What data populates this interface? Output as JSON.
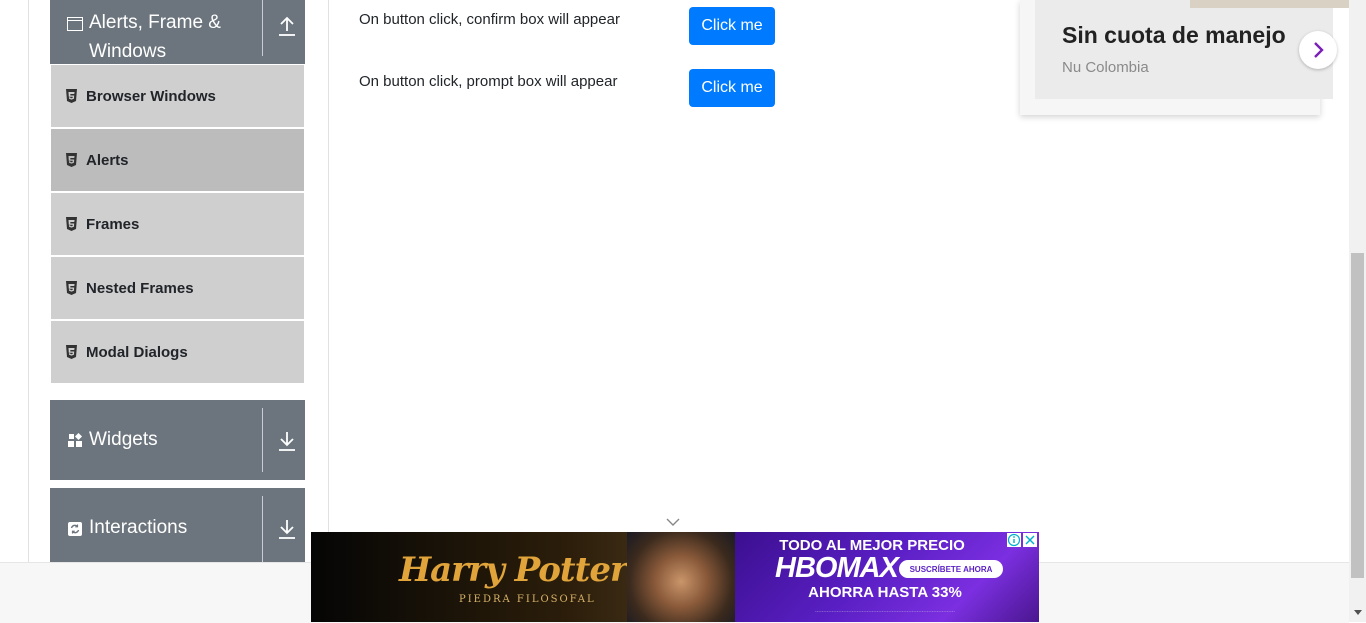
{
  "sidebar": {
    "alerts_group": {
      "label_line1": "Alerts, Frame &",
      "label_line2": "Windows"
    },
    "items": [
      {
        "label": "Browser Windows"
      },
      {
        "label": "Alerts"
      },
      {
        "label": "Frames"
      },
      {
        "label": "Nested Frames"
      },
      {
        "label": "Modal Dialogs"
      }
    ],
    "widgets_group": {
      "label": "Widgets"
    },
    "interactions_group": {
      "label": "Interactions"
    }
  },
  "main": {
    "confirm_row": {
      "text": "On button click, confirm box will appear",
      "button_label": "Click me"
    },
    "prompt_row": {
      "text": "On button click, prompt box will appear",
      "button_label": "Click me"
    }
  },
  "ad_card": {
    "title": "Sin cuota de manejo",
    "subtitle": "Nu Colombia",
    "arrow_icon": "chevron-right-icon"
  },
  "banner": {
    "left": {
      "title": "Harry Potter",
      "subtitle": "PIEDRA FILOSOFAL"
    },
    "right": {
      "headline": "TODO AL MEJOR PRECIO",
      "logo": "HBOMAX",
      "cta": "SUSCRÍBETE AHORA",
      "discount": "AHORRA HASTA 33%"
    }
  },
  "colors": {
    "sidebar_header": "#6c757d",
    "menu_item": "#cfcfcf",
    "menu_item_active": "#bcbcbc",
    "primary_button": "#007bff"
  }
}
